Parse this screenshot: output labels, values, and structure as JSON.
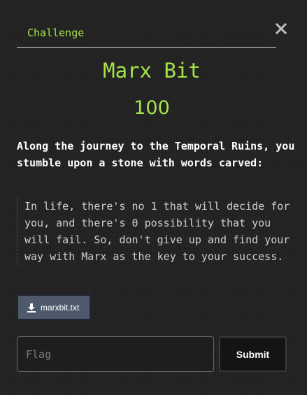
{
  "tabs": [
    {
      "label": "Challenge"
    }
  ],
  "close_icon": "close-icon",
  "challenge": {
    "name": "Marx Bit",
    "points": "100",
    "description": "Along the journey to the Temporal Ruins, you stumble upon a stone with words carved:",
    "quote": "In life, there's no 1 that will decide for you, and there's 0 possibility that you will fail. So, don't give up and find your way with Marx as the key to your success."
  },
  "file": {
    "icon": "download-icon",
    "name": "marxbit.txt"
  },
  "flag_input": {
    "placeholder": "Flag",
    "value": ""
  },
  "submit": {
    "label": "Submit"
  },
  "colors": {
    "accent": "#a6e34a",
    "background": "#232323",
    "file_button": "#4e5a6b"
  }
}
